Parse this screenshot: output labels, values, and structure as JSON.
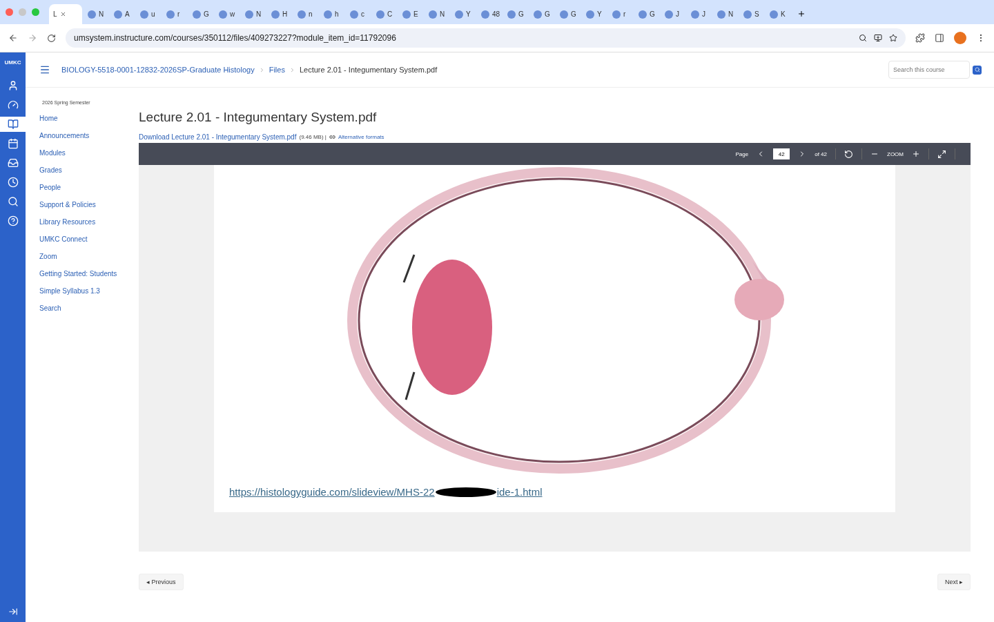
{
  "browser": {
    "tabs": [
      {
        "title": "L",
        "selected": true
      },
      {
        "title": "N",
        "selected": false
      },
      {
        "title": "A",
        "selected": false
      },
      {
        "title": "u",
        "selected": false
      },
      {
        "title": "r",
        "selected": false
      },
      {
        "title": "G",
        "selected": false
      },
      {
        "title": "w",
        "selected": false
      },
      {
        "title": "N",
        "selected": false
      },
      {
        "title": "H",
        "selected": false
      },
      {
        "title": "n",
        "selected": false
      },
      {
        "title": "h",
        "selected": false
      },
      {
        "title": "c",
        "selected": false
      },
      {
        "title": "C",
        "selected": false
      },
      {
        "title": "E",
        "selected": false
      },
      {
        "title": "N",
        "selected": false
      },
      {
        "title": "Y",
        "selected": false
      },
      {
        "title": "48",
        "selected": false
      },
      {
        "title": "G",
        "selected": false
      },
      {
        "title": "G",
        "selected": false
      },
      {
        "title": "G",
        "selected": false
      },
      {
        "title": "Y",
        "selected": false
      },
      {
        "title": "r",
        "selected": false
      },
      {
        "title": "G",
        "selected": false
      },
      {
        "title": "J",
        "selected": false
      },
      {
        "title": "J",
        "selected": false
      },
      {
        "title": "N",
        "selected": false
      },
      {
        "title": "S",
        "selected": false
      },
      {
        "title": "K",
        "selected": false
      }
    ],
    "url": "umsystem.instructure.com/courses/350112/files/409273227?module_item_id=11792096"
  },
  "global_nav": {
    "logo": "UMKC",
    "items": [
      {
        "kind": "account",
        "selected": false
      },
      {
        "kind": "dashboard",
        "selected": false
      },
      {
        "kind": "courses",
        "selected": true
      },
      {
        "kind": "calendar",
        "selected": false
      },
      {
        "kind": "inbox",
        "selected": false
      },
      {
        "kind": "history",
        "selected": false
      },
      {
        "kind": "search",
        "selected": false
      },
      {
        "kind": "help",
        "selected": false
      }
    ]
  },
  "breadcrumbs": [
    "BIOLOGY-5518-0001-12832-2026SP-Graduate Histology",
    "Files",
    "Lecture 2.01 - Integumentary System.pdf"
  ],
  "search": {
    "placeholder": "Search this course"
  },
  "course_nav": {
    "term": "2026 Spring Semester",
    "items": [
      {
        "label": "Home",
        "selected": false
      },
      {
        "label": "Announcements",
        "selected": false
      },
      {
        "label": "Modules",
        "selected": false
      },
      {
        "label": "Grades",
        "selected": false
      },
      {
        "label": "People",
        "selected": false
      },
      {
        "label": "Support & Policies",
        "selected": false
      },
      {
        "label": "Library Resources",
        "selected": false
      },
      {
        "label": "UMKC Connect",
        "selected": false
      },
      {
        "label": "Zoom",
        "selected": false
      },
      {
        "label": "Getting Started: Students",
        "selected": false
      },
      {
        "label": "Simple Syllabus 1.3",
        "selected": false
      },
      {
        "label": "Search",
        "selected": false
      }
    ]
  },
  "file": {
    "title": "Lecture 2.01 - Integumentary System.pdf",
    "download": "Download Lecture 2.01 - Integumentary System.pdf",
    "size": "(9.46 MB) |",
    "alt_formats": "Alternative formats"
  },
  "viewer": {
    "page_label": "Page",
    "page": "42",
    "of": "of 42",
    "zoom": "ZOOM",
    "link_start": "https://histologyguide.com/slideview/MHS-22",
    "link_end": "ide-1.html"
  },
  "pager": {
    "previous": "◂ Previous",
    "next": "Next ▸"
  }
}
